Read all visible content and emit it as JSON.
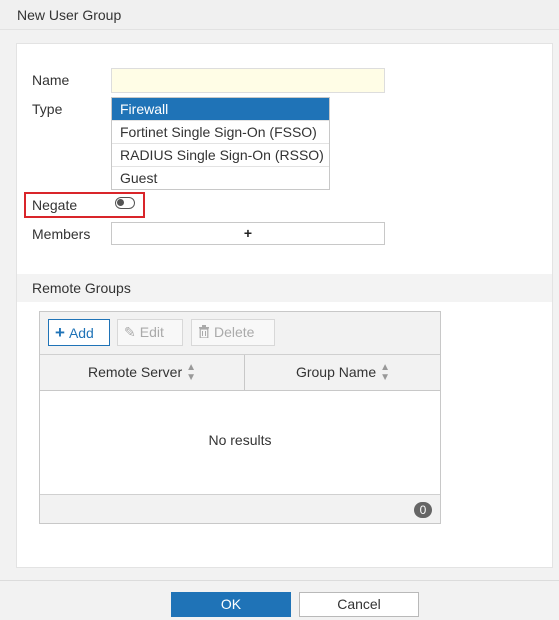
{
  "window": {
    "title": "New User Group"
  },
  "form": {
    "name_label": "Name",
    "name_value": "",
    "type_label": "Type",
    "type_options": [
      "Firewall",
      "Fortinet Single Sign-On (FSSO)",
      "RADIUS Single Sign-On (RSSO)",
      "Guest"
    ],
    "type_selected": "Firewall",
    "negate_label": "Negate",
    "negate_enabled": false,
    "members_label": "Members",
    "members_add_icon": "+"
  },
  "remote_groups": {
    "title": "Remote Groups",
    "toolbar": {
      "add": "Add",
      "edit": "Edit",
      "delete": "Delete"
    },
    "columns": [
      "Remote Server",
      "Group Name"
    ],
    "empty_text": "No results",
    "count": "0"
  },
  "footer": {
    "ok": "OK",
    "cancel": "Cancel"
  },
  "colors": {
    "accent": "#1f73b7",
    "highlight_border": "#d9252a",
    "name_field_bg": "#fffde6"
  }
}
